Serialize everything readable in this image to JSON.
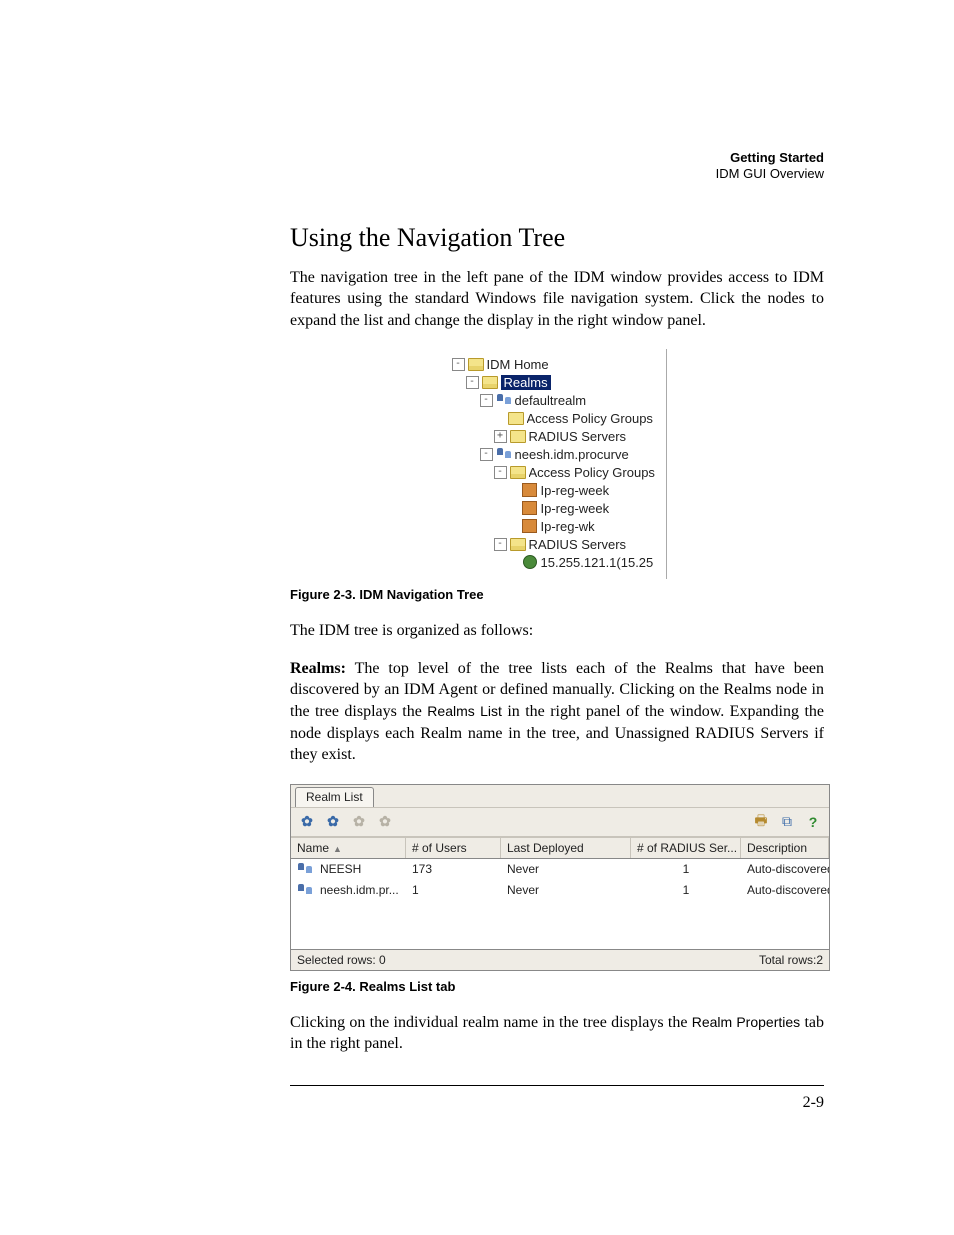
{
  "header": {
    "title": "Getting Started",
    "subtitle": "IDM GUI Overview"
  },
  "section_title": "Using the Navigation Tree",
  "para1": "The navigation tree in the left pane of the IDM window provides access to IDM features using the standard Windows file navigation system. Click the nodes to expand the list and change the display in the right window panel.",
  "fig1_caption": "Figure 2-3. IDM Navigation Tree",
  "para2": "The IDM tree is organized as follows:",
  "realms_para": {
    "lead": "Realms:",
    "rest_a": " The top level of the tree lists each of the Realms that have been discovered by an IDM Agent or defined manually. Clicking on the Realms node in the tree displays the ",
    "ui_term": "Realms List",
    "rest_b": " in the right panel of the window. Expanding the node displays each Realm name in the tree, and Unassigned RADIUS Servers if they exist."
  },
  "fig2_caption": "Figure 2-4. Realms List tab",
  "para3_a": "Clicking on the individual realm name in the tree displays the ",
  "para3_ui": "Realm Properties",
  "para3_b": " tab in the right panel.",
  "nav_tree": {
    "n0": "IDM Home",
    "n1": "Realms",
    "n2": "defaultrealm",
    "n3": "Access Policy Groups",
    "n4": "RADIUS Servers",
    "n5": "neesh.idm.procurve",
    "n6": "Access Policy Groups",
    "n7": "Ip-reg-week",
    "n8": "Ip-reg-week",
    "n9": "Ip-reg-wk",
    "n10": "RADIUS Servers",
    "n11": "15.255.121.1(15.25"
  },
  "realm_list": {
    "tab_label": "Realm List",
    "columns": {
      "c0": "Name",
      "c1": "# of Users",
      "c2": "Last Deployed",
      "c3": "# of RADIUS Ser...",
      "c4": "Description"
    },
    "rows": [
      {
        "name": "NEESH",
        "users": "173",
        "deployed": "Never",
        "radius": "1",
        "desc": "Auto-discovered ..."
      },
      {
        "name": "neesh.idm.pr...",
        "users": "1",
        "deployed": "Never",
        "radius": "1",
        "desc": "Auto-discovered ..."
      }
    ],
    "status_left": "Selected rows: 0",
    "status_right": "Total rows:2"
  },
  "page_number": "2-9"
}
